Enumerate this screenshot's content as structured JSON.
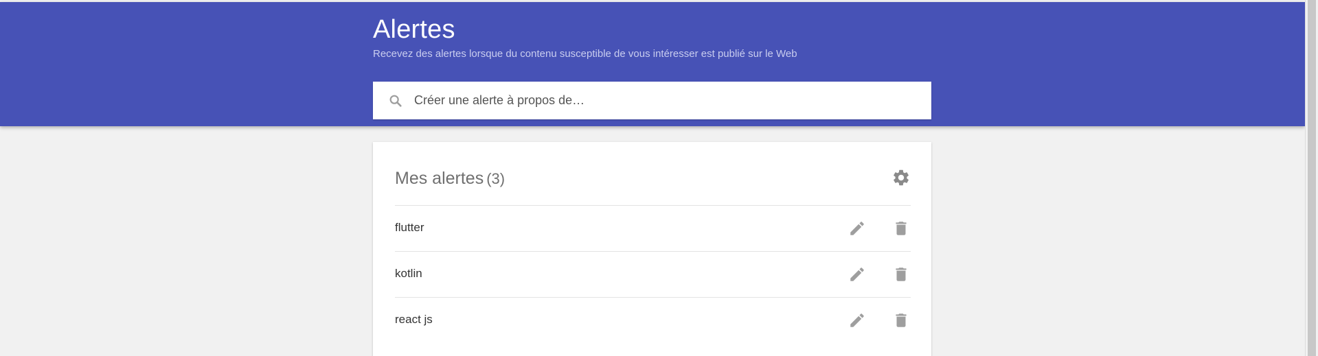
{
  "header": {
    "title": "Alertes",
    "subtitle": "Recevez des alertes lorsque du contenu susceptible de vous intéresser est publié sur le Web",
    "background_color": "#4752b6"
  },
  "search": {
    "placeholder": "Créer une alerte à propos de…",
    "value": "",
    "icon": "search-icon"
  },
  "alerts_card": {
    "title": "Mes alertes",
    "count": "(3)",
    "settings_icon": "gear-icon",
    "items": [
      {
        "label": "flutter",
        "edit_icon": "pencil-icon",
        "delete_icon": "trash-icon"
      },
      {
        "label": "kotlin",
        "edit_icon": "pencil-icon",
        "delete_icon": "trash-icon"
      },
      {
        "label": "react js",
        "edit_icon": "pencil-icon",
        "delete_icon": "trash-icon"
      }
    ]
  }
}
